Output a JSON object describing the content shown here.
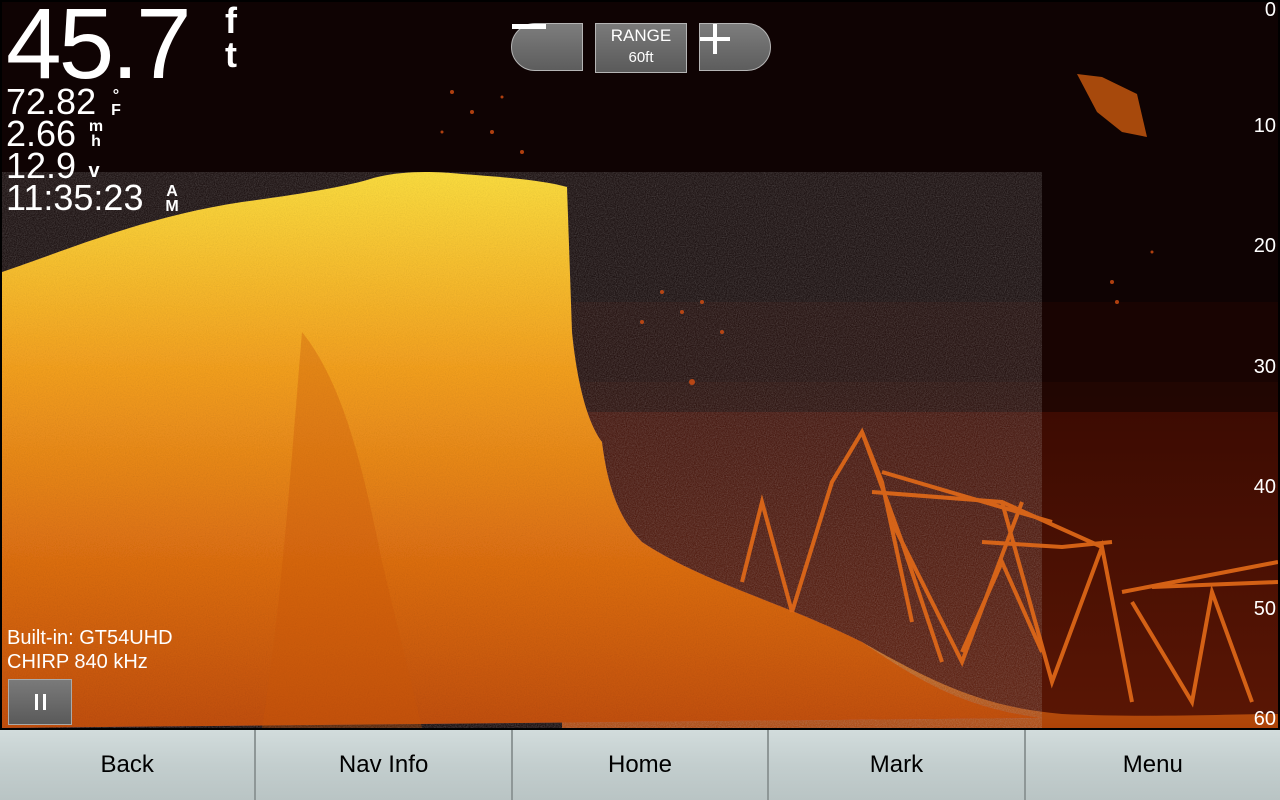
{
  "readouts": {
    "depth": "45.7",
    "depth_unit_top": "f",
    "depth_unit_bottom": "t",
    "water_temp": "72.82",
    "water_temp_unit_top": "°",
    "water_temp_unit_bottom": "F",
    "speed": "2.66",
    "speed_unit_top": "m",
    "speed_unit_bottom": "h",
    "voltage": "12.9",
    "voltage_unit": "v",
    "time": "11:35:23",
    "time_unit_top": "A",
    "time_unit_bottom": "M"
  },
  "range": {
    "title": "RANGE",
    "value": "60ft",
    "zoom_out_icon": "minus-icon",
    "zoom_in_icon": "plus-icon"
  },
  "depth_scale": [
    "0",
    "10",
    "20",
    "30",
    "40",
    "50",
    "60"
  ],
  "sonar_info": {
    "transducer": "Built-in: GT54UHD",
    "frequency": "CHIRP 840 kHz"
  },
  "pause_icon": "pause-icon",
  "softkeys": [
    "Back",
    "Nav Info",
    "Home",
    "Mark",
    "Menu"
  ],
  "colors": {
    "sonar_background": "#0f0303",
    "sonar_strong": "#ffd23a",
    "sonar_medium": "#e2740f",
    "sonar_weak": "#7a1a04",
    "softkey_bg": "#c7d1d1"
  }
}
